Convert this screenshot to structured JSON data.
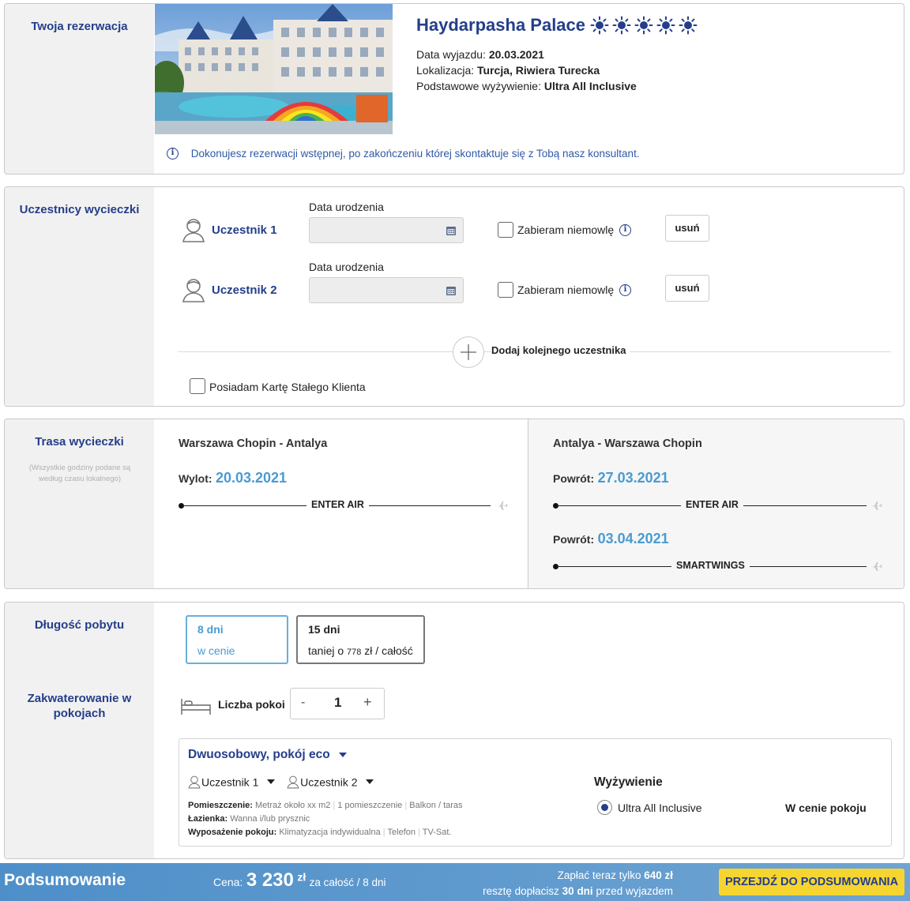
{
  "reservation": {
    "side_title": "Twoja rezerwacja",
    "hotel_name": "Haydarpasha Palace",
    "stars": 5,
    "departure_label": "Data wyjazdu:",
    "departure_value": "20.03.2021",
    "location_label": "Lokalizacja:",
    "location_value": "Turcja, Riwiera Turecka",
    "board_label": "Podstawowe wyżywienie:",
    "board_value": "Ultra All Inclusive",
    "info_text": "Dokonujesz rezerwacji wstępnej, po zakończeniu której skontaktuje się z Tobą nasz konsultant."
  },
  "participants": {
    "side_title": "Uczestnicy wycieczki",
    "items": [
      {
        "name": "Uczestnik 1",
        "dob_label": "Data urodzenia",
        "infant_label": "Zabieram niemowlę",
        "remove_label": "usuń"
      },
      {
        "name": "Uczestnik 2",
        "dob_label": "Data urodzenia",
        "infant_label": "Zabieram niemowlę",
        "remove_label": "usuń"
      }
    ],
    "add_label": "Dodaj kolejnego uczestnika",
    "loyalty_label": "Posiadam Kartę Stałego Klienta"
  },
  "route": {
    "side_title": "Trasa wycieczki",
    "side_note": "(Wszystkie godziny podane są według czasu lokalnego)",
    "outbound": {
      "title": "Warszawa Chopin - Antalya",
      "label": "Wylot:",
      "date": "20.03.2021",
      "airline": "ENTER AIR"
    },
    "return": {
      "title": "Antalya - Warszawa Chopin",
      "flights": [
        {
          "label": "Powrót:",
          "date": "27.03.2021",
          "airline": "ENTER AIR"
        },
        {
          "label": "Powrót:",
          "date": "03.04.2021",
          "airline": "SMARTWINGS"
        }
      ]
    }
  },
  "stay": {
    "side_title": "Długość pobytu",
    "options": [
      {
        "days": "8 dni",
        "desc": "w cenie"
      },
      {
        "days": "15 dni",
        "desc_prefix": "taniej o",
        "desc_amount": "778",
        "desc_suffix": "zł / całość"
      }
    ]
  },
  "rooms": {
    "side_title": "Zakwaterowanie w pokojach",
    "count_label": "Liczba pokoi",
    "count_value": "1",
    "minus": "-",
    "plus": "+",
    "room_type": "Dwuosobowy, pokój eco",
    "participant_a": "Uczestnik 1",
    "participant_b": "Uczestnik 2",
    "details": {
      "room_label": "Pomieszczenie:",
      "room_values": [
        "Metraż około xx m2",
        "1 pomieszczenie",
        "Balkon / taras"
      ],
      "bath_label": "Łazienka:",
      "bath_value": "Wanna i/lub prysznic",
      "equip_label": "Wyposażenie pokoju:",
      "equip_values": [
        "Klimatyzacja indywidualna",
        "Telefon",
        "TV-Sat."
      ]
    },
    "board_title": "Wyżywienie",
    "board_option": "Ultra All Inclusive",
    "board_price": "W cenie pokoju"
  },
  "summary": {
    "title": "Podsumowanie",
    "price_label": "Cena:",
    "price_value": "3 230",
    "currency": "zł",
    "price_note": "za całość / 8 dni",
    "pay_now_prefix": "Zapłać teraz tylko",
    "pay_now_value": "640 zł",
    "rest_prefix": "resztę dopłacisz",
    "rest_days": "30 dni",
    "rest_suffix": "przed wyjazdem",
    "cta_label": "PRZEJDŹ DO PODSUMOWANIA"
  },
  "colors": {
    "brand_blue": "#243e8a",
    "date_blue": "#4a9bd1",
    "cta_yellow": "#f7d531"
  }
}
